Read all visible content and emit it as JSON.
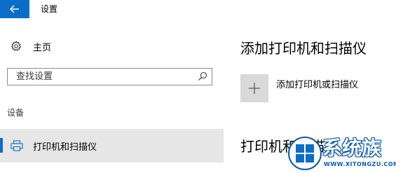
{
  "titlebar": {
    "title": "设置",
    "back_icon": "back-arrow-icon",
    "accent_color": "#0a6ec9"
  },
  "sidebar": {
    "home_label": "主页",
    "home_icon": "gear-icon",
    "search": {
      "placeholder": "查找设置",
      "icon": "search-icon"
    },
    "group_label": "设备",
    "selected_item": {
      "label": "打印机和扫描仪",
      "icon": "printer-icon"
    }
  },
  "main": {
    "heading": "添加打印机和扫描仪",
    "add_label": "添加打印机或扫描仪",
    "add_icon": "plus-icon",
    "section_heading": "打印机和扫描仪"
  },
  "watermark": {
    "text": "系统族",
    "url": "WWW.XITONGZU.COM"
  }
}
